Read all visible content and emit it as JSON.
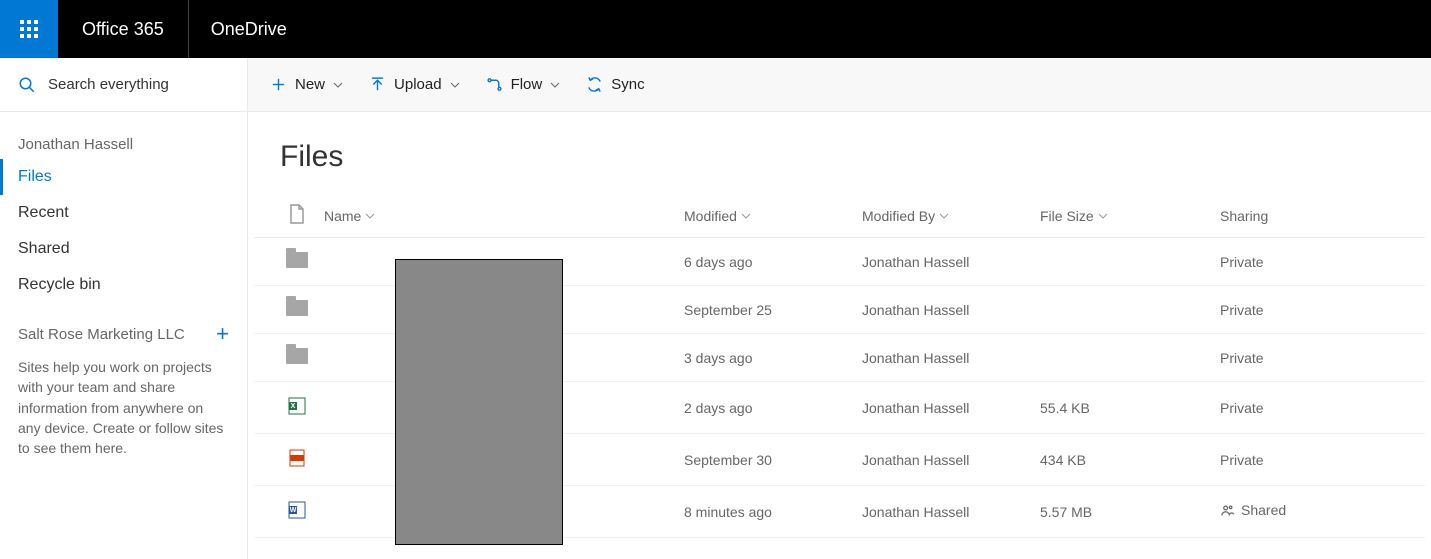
{
  "header": {
    "suite": "Office 365",
    "app": "OneDrive"
  },
  "search": {
    "placeholder": "Search everything"
  },
  "owner": "Jonathan Hassell",
  "nav": {
    "items": [
      {
        "label": "Files",
        "active": true
      },
      {
        "label": "Recent",
        "active": false
      },
      {
        "label": "Shared",
        "active": false
      },
      {
        "label": "Recycle bin",
        "active": false
      }
    ]
  },
  "sites": {
    "title": "Salt Rose Marketing LLC",
    "help": "Sites help you work on projects with your team and share information from anywhere on any device. Create or follow sites to see them here."
  },
  "commands": {
    "new": "New",
    "upload": "Upload",
    "flow": "Flow",
    "sync": "Sync"
  },
  "page": {
    "title": "Files"
  },
  "columns": {
    "name": "Name",
    "modified": "Modified",
    "modified_by": "Modified By",
    "size": "File Size",
    "sharing": "Sharing"
  },
  "rows": [
    {
      "type": "folder",
      "modified": "6 days ago",
      "by": "Jonathan Hassell",
      "size": "",
      "sharing": "Private"
    },
    {
      "type": "folder",
      "modified": "September 25",
      "by": "Jonathan Hassell",
      "size": "",
      "sharing": "Private"
    },
    {
      "type": "folder",
      "modified": "3 days ago",
      "by": "Jonathan Hassell",
      "size": "",
      "sharing": "Private"
    },
    {
      "type": "excel",
      "modified": "2 days ago",
      "by": "Jonathan Hassell",
      "size": "55.4 KB",
      "sharing": "Private"
    },
    {
      "type": "pdf",
      "modified": "September 30",
      "by": "Jonathan Hassell",
      "size": "434 KB",
      "sharing": "Private"
    },
    {
      "type": "word",
      "modified": "8 minutes ago",
      "by": "Jonathan Hassell",
      "size": "5.57 MB",
      "sharing": "Shared"
    }
  ]
}
